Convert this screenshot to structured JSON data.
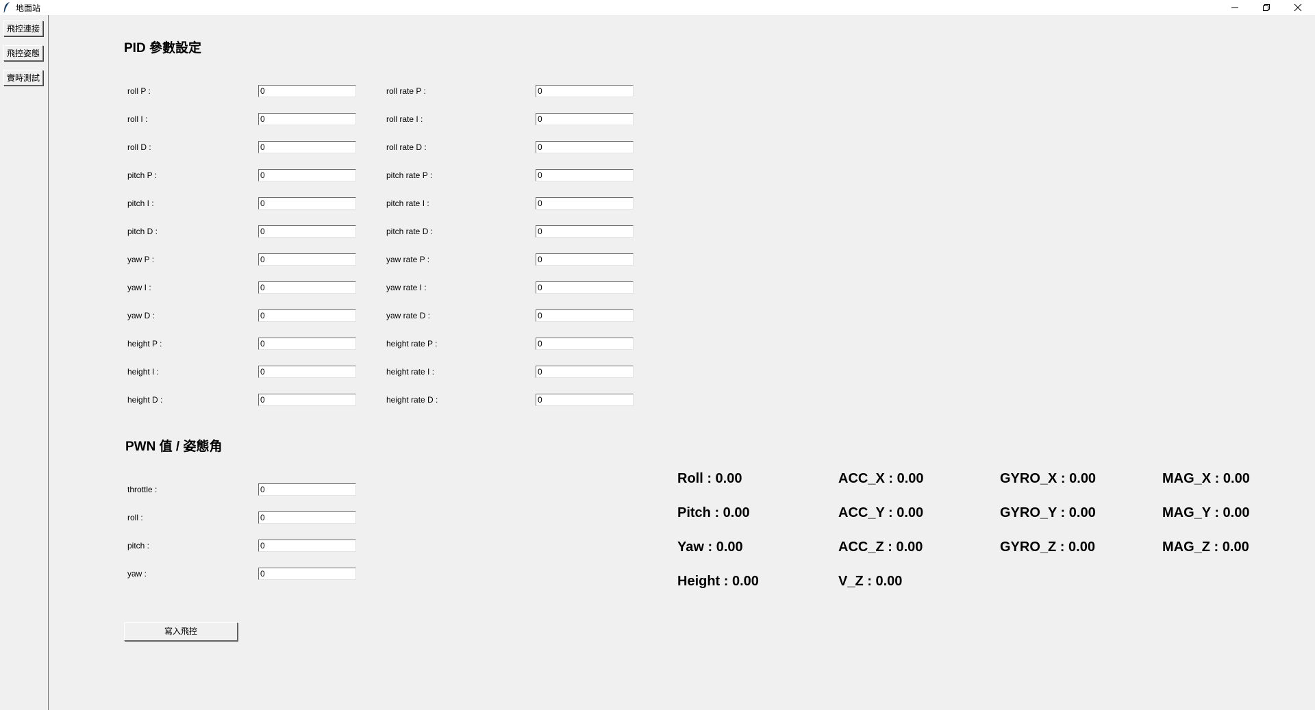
{
  "window": {
    "title": "地面站"
  },
  "sidebar": {
    "items": [
      {
        "label": "飛控連接"
      },
      {
        "label": "飛控姿態"
      },
      {
        "label": "實時測試"
      }
    ]
  },
  "pid": {
    "title": "PID 參數設定",
    "left": [
      {
        "label": "roll P :",
        "value": "0"
      },
      {
        "label": "roll I :",
        "value": "0"
      },
      {
        "label": "roll D :",
        "value": "0"
      },
      {
        "label": "pitch P :",
        "value": "0"
      },
      {
        "label": "pitch I :",
        "value": "0"
      },
      {
        "label": "pitch D :",
        "value": "0"
      },
      {
        "label": "yaw P :",
        "value": "0"
      },
      {
        "label": "yaw I :",
        "value": "0"
      },
      {
        "label": "yaw D :",
        "value": "0"
      },
      {
        "label": "height P :",
        "value": "0"
      },
      {
        "label": "height I :",
        "value": "0"
      },
      {
        "label": "height D :",
        "value": "0"
      }
    ],
    "right": [
      {
        "label": "roll rate P :",
        "value": "0"
      },
      {
        "label": "roll rate I :",
        "value": "0"
      },
      {
        "label": "roll rate D :",
        "value": "0"
      },
      {
        "label": "pitch rate P :",
        "value": "0"
      },
      {
        "label": "pitch rate I :",
        "value": "0"
      },
      {
        "label": "pitch rate D :",
        "value": "0"
      },
      {
        "label": "yaw rate P :",
        "value": "0"
      },
      {
        "label": "yaw rate I :",
        "value": "0"
      },
      {
        "label": "yaw rate D :",
        "value": "0"
      },
      {
        "label": "height rate P :",
        "value": "0"
      },
      {
        "label": "height rate I :",
        "value": "0"
      },
      {
        "label": "height rate D :",
        "value": "0"
      }
    ]
  },
  "pwm": {
    "title": "PWN 值 / 姿態角",
    "fields": [
      {
        "label": "throttle :",
        "value": "0"
      },
      {
        "label": "roll :",
        "value": "0"
      },
      {
        "label": "pitch :",
        "value": "0"
      },
      {
        "label": "yaw :",
        "value": "0"
      }
    ],
    "write_button": "寫入飛控"
  },
  "readouts": {
    "attitude": [
      "Roll : 0.00",
      "Pitch : 0.00",
      "Yaw : 0.00",
      "Height : 0.00"
    ],
    "acc": [
      "ACC_X : 0.00",
      "ACC_Y : 0.00",
      "ACC_Z : 0.00",
      "V_Z : 0.00"
    ],
    "gyro": [
      "GYRO_X : 0.00",
      "GYRO_Y : 0.00",
      "GYRO_Z : 0.00"
    ],
    "mag": [
      "MAG_X : 0.00",
      "MAG_Y : 0.00",
      "MAG_Z : 0.00"
    ]
  },
  "icons": {
    "app": "feather-icon",
    "minimize": "minimize-icon",
    "maximize": "restore-icon",
    "close": "close-icon"
  }
}
